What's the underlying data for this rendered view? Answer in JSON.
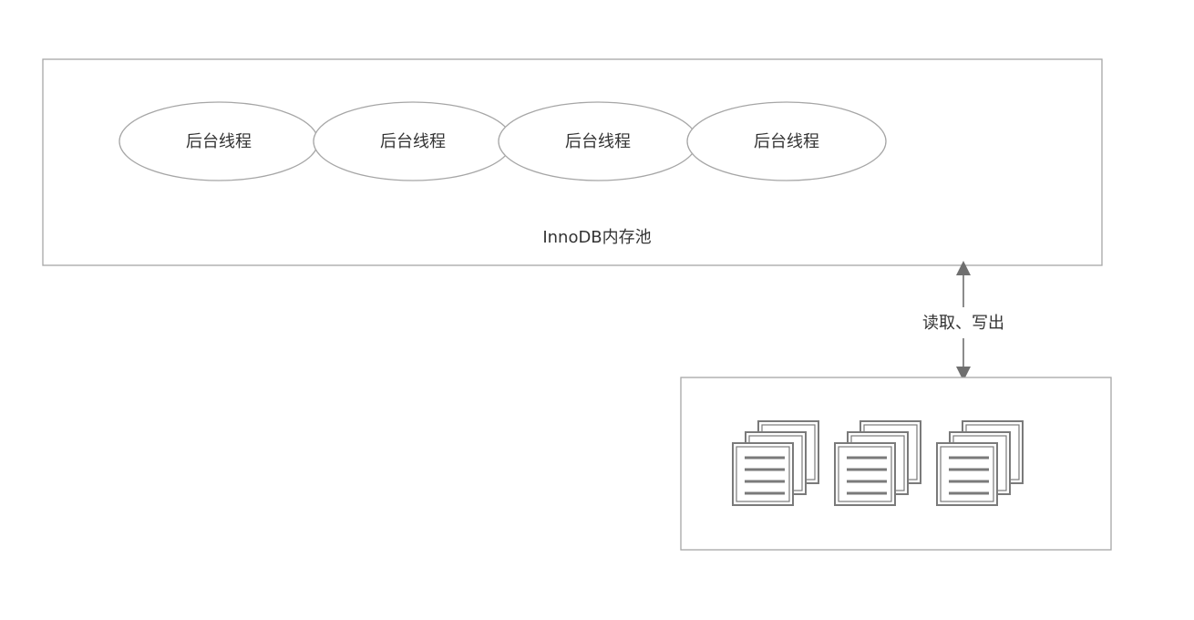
{
  "pool": {
    "label": "InnoDB内存池",
    "threads": [
      {
        "label": "后台线程"
      },
      {
        "label": "后台线程"
      },
      {
        "label": "后台线程"
      },
      {
        "label": "后台线程"
      }
    ]
  },
  "link": {
    "label": "读取、写出"
  },
  "disk": {
    "file_stacks": [
      {
        "icon": "file-stack-icon"
      },
      {
        "icon": "file-stack-icon"
      },
      {
        "icon": "file-stack-icon"
      }
    ]
  },
  "colors": {
    "stroke": "#a6a6a6",
    "arrow": "#6f6f6f",
    "text": "#333333",
    "icon": "#7a7a7a",
    "background": "#ffffff"
  }
}
